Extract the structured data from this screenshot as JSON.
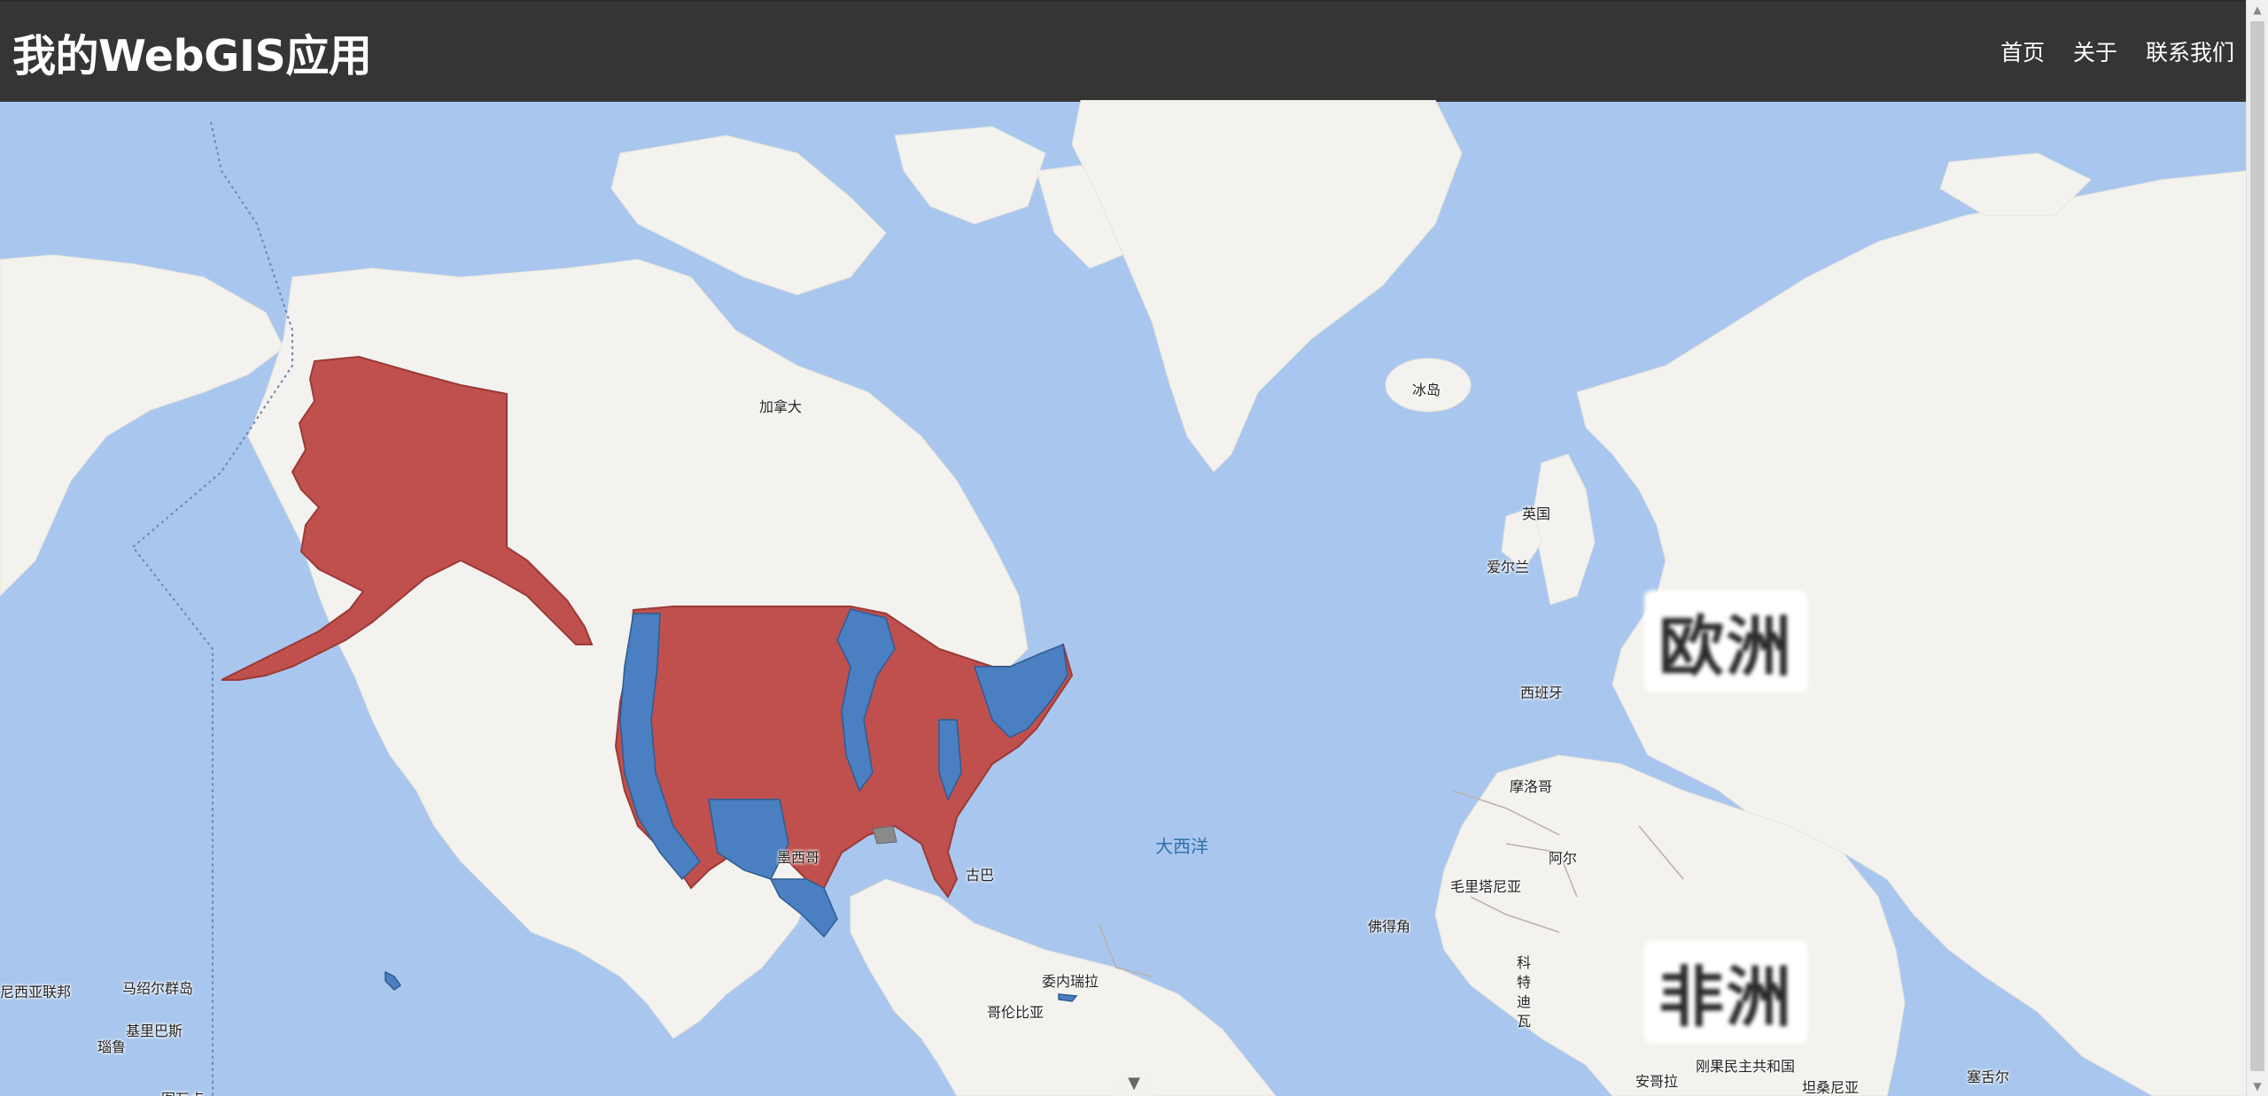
{
  "header": {
    "title": "我的WebGIS应用",
    "nav": [
      "首页",
      "关于",
      "联系我们"
    ]
  },
  "map": {
    "labels": {
      "canada": "加拿大",
      "iceland": "冰岛",
      "uk": "英国",
      "ireland": "爱尔兰",
      "spain": "西班牙",
      "morocco": "摩洛哥",
      "algeria": "阿尔",
      "mauritania": "毛里塔尼亚",
      "cape_verde": "佛得角",
      "mexico": "墨西哥",
      "cuba": "古巴",
      "venezuela": "委内瑞拉",
      "colombia": "哥伦比亚",
      "atlantic": "大西洋",
      "micronesia": "尼西亚联邦",
      "marshall": "马绍尔群岛",
      "kiribati": "基里巴斯",
      "nauru": "瑙鲁",
      "tuvalu": "图瓦卢",
      "cote_divoire": "科特迪瓦",
      "angola": "安哥拉",
      "drc": "刚果民主共和国",
      "tanzania": "坦桑尼亚",
      "seychelles": "塞舌尔",
      "europe": "欧洲",
      "africa": "非洲"
    },
    "zoom_icon": "chevron-down-icon",
    "colors": {
      "ocean": "#a9c7ee",
      "land": "#f3f2ee",
      "red": "#c0504d",
      "blue": "#4a7fc1",
      "gray": "#8a8a8a"
    }
  }
}
